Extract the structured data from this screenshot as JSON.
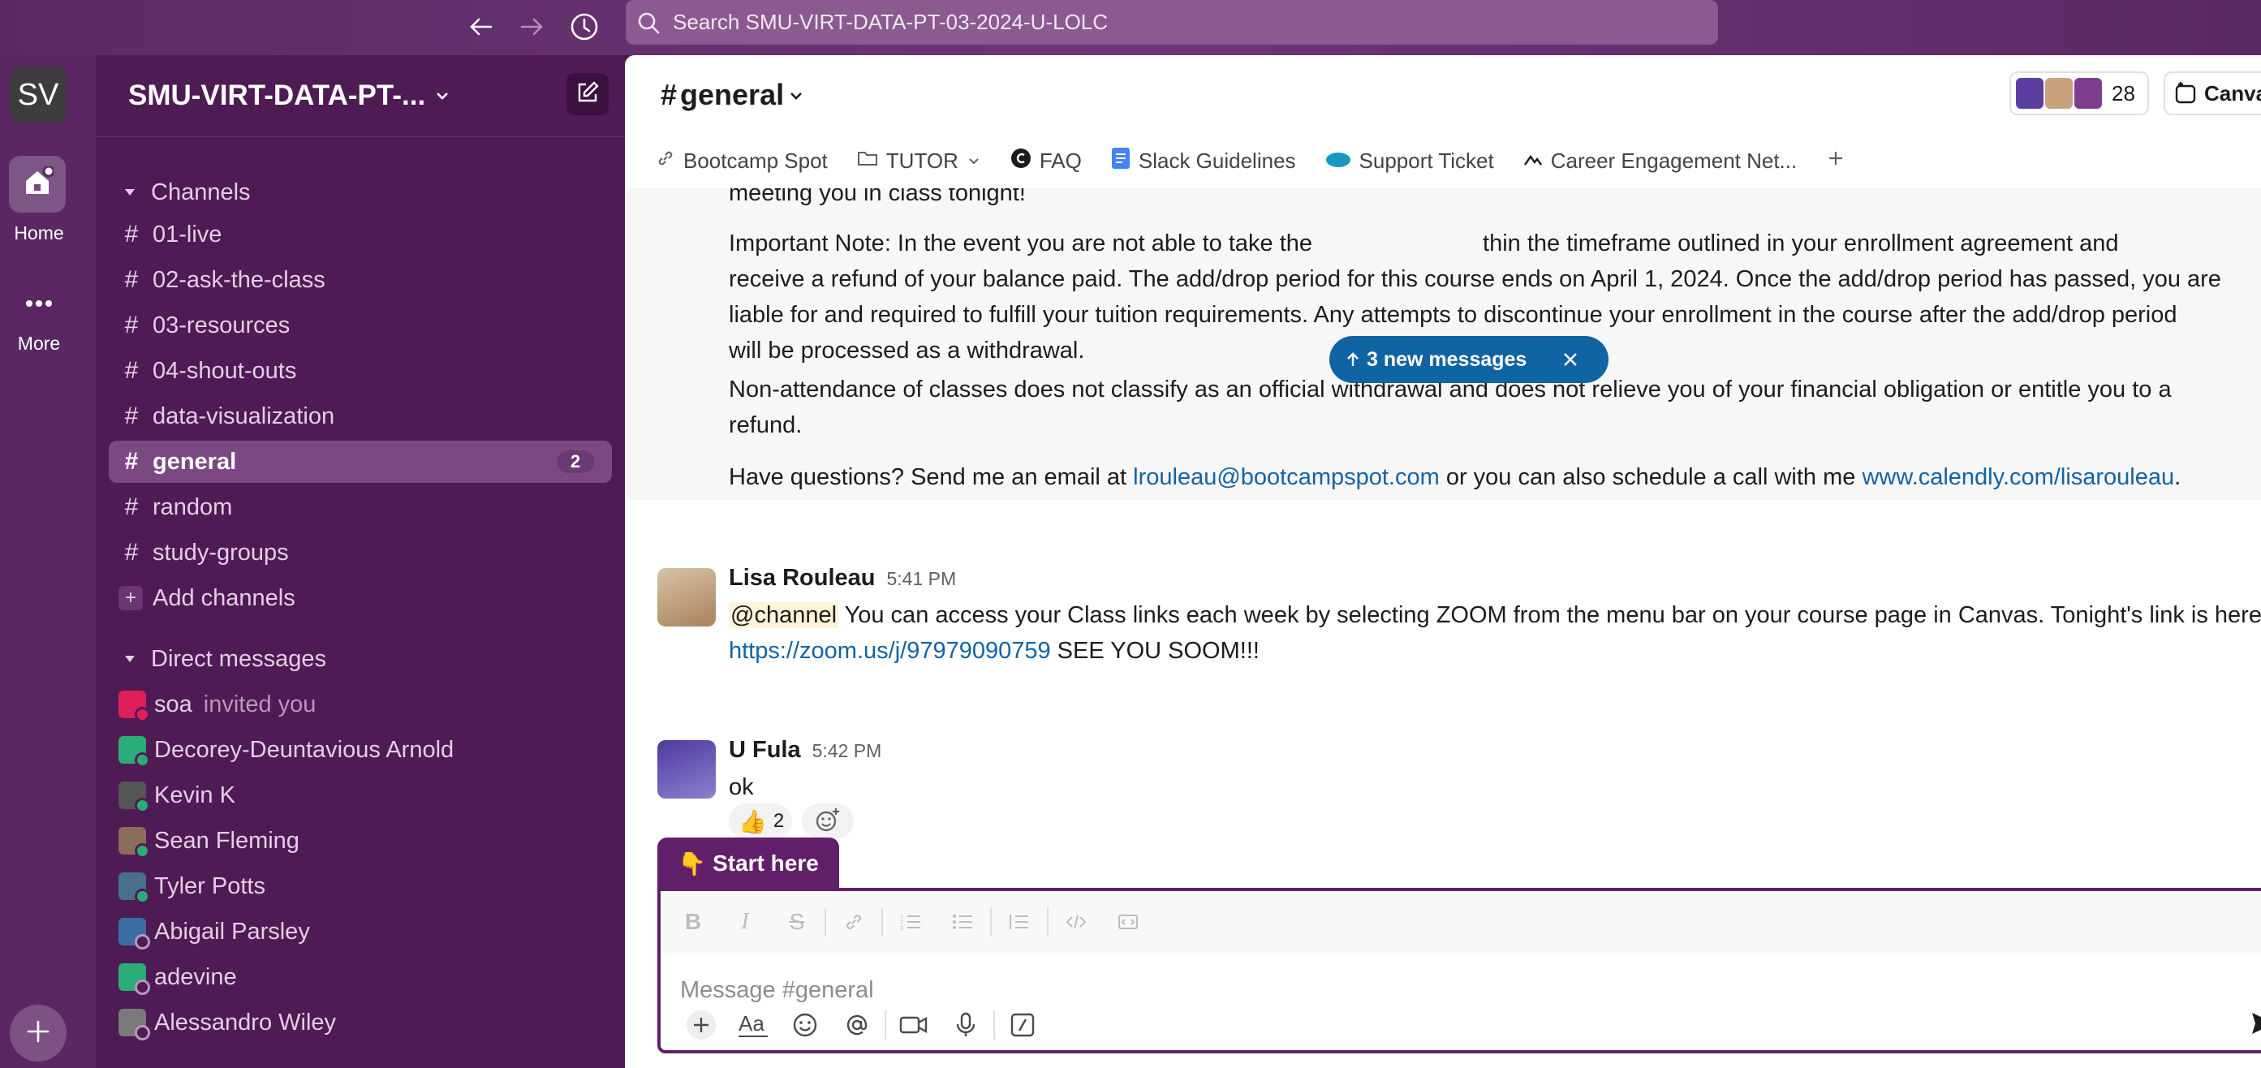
{
  "search": {
    "placeholder": "Search SMU-VIRT-DATA-PT-03-2024-U-LOLC"
  },
  "rail": {
    "workspace_initials": "SV",
    "home_label": "Home",
    "more_label": "More"
  },
  "sidebar": {
    "workspace_name": "SMU-VIRT-DATA-PT-...",
    "channels_header": "Channels",
    "channels": [
      {
        "name": "01-live"
      },
      {
        "name": "02-ask-the-class"
      },
      {
        "name": "03-resources"
      },
      {
        "name": "04-shout-outs"
      },
      {
        "name": "data-visualization"
      },
      {
        "name": "general",
        "badge": "2",
        "active": true
      },
      {
        "name": "random"
      },
      {
        "name": "study-groups"
      }
    ],
    "add_channels": "Add channels",
    "dm_header": "Direct messages",
    "dms": [
      {
        "name": "soa",
        "note": "invited you",
        "color": "#e01e5a"
      },
      {
        "name": "Decorey-Deuntavious Arnold",
        "color": "#2bac76"
      },
      {
        "name": "Kevin K",
        "color": "#555555"
      },
      {
        "name": "Sean Fleming",
        "color": "#8a6d5a"
      },
      {
        "name": "Tyler Potts",
        "color": "#4a6f8a"
      },
      {
        "name": "Abigail Parsley",
        "color": "#3a6ea5"
      },
      {
        "name": "adevine",
        "color": "#2bac76"
      },
      {
        "name": "Alessandro Wiley",
        "color": "#7a7a7a"
      }
    ]
  },
  "channel": {
    "title": "general",
    "member_count": "28",
    "canvas_label": "Canva"
  },
  "bookmarks": [
    {
      "label": "Bootcamp Spot",
      "icon": "link-icon"
    },
    {
      "label": "TUTOR",
      "icon": "folder-icon"
    },
    {
      "label": "FAQ",
      "icon": "faq-icon"
    },
    {
      "label": "Slack Guidelines",
      "icon": "doc-icon"
    },
    {
      "label": "Support Ticket",
      "icon": "salesforce-icon"
    },
    {
      "label": "Career Engagement Net...",
      "icon": "career-icon"
    }
  ],
  "messages": {
    "top_fragment": "meeting you in class tonight!",
    "important_note": "Important Note: In the event you are not able to take the course ... within the timeframe outlined in your enrollment agreement and receive a refund of your balance paid. The add/drop period for this course ends on April 1, 2024.  Once the add/drop period has passed, you are liable for and required to fulfill your tuition requirements. Any attempts to discontinue your enrollment in the course after the add/drop period will be processed as a withdrawal.",
    "important_note_l1": "Important Note: In the event you are not able to take the",
    "important_note_l1b": "thin the timeframe outlined in your enrollment agreement and",
    "important_note_l2": "receive a refund of your balance paid. The add/drop period for this course ends on April 1, 2024.  Once the add/drop period has passed, you are",
    "important_note_l3": "liable for and required to fulfill your tuition requirements. Any attempts to discontinue your enrollment in the course after the add/drop period",
    "important_note_l4": "will be processed as a withdrawal.",
    "non_attendance_l1": "Non-attendance of classes does not classify as an official withdrawal and does not relieve you of your financial obligation or entitle you to a",
    "non_attendance_l2": "refund.",
    "questions_pre": "Have questions? Send me an email at ",
    "questions_email": "lrouleau@bootcampspot.com",
    "questions_mid": " or you can also schedule a call with me ",
    "questions_link": "www.calendly.com/lisarouleau",
    "questions_end": ".",
    "new_messages": "3 new messages",
    "m1_sender": "Lisa Rouleau",
    "m1_time": "5:41 PM",
    "m1_mention": "@channel",
    "m1_text": " You can access your Class links each week by selecting ZOOM from the menu bar on your course page in Canvas. Tonight's link is here",
    "m1_link": "https://zoom.us/j/97979090759",
    "m1_after": "  SEE YOU SOOM!!!",
    "m1_reaction_count": "2",
    "m2_sender": "U Fula",
    "m2_time": "5:42 PM",
    "m2_text": "ok"
  },
  "composer": {
    "start_here": "Start here",
    "placeholder": "Message #general"
  },
  "colors": {
    "aubergine": "#4a154b",
    "link": "#1264a3",
    "accent_blue": "#1164a3"
  }
}
